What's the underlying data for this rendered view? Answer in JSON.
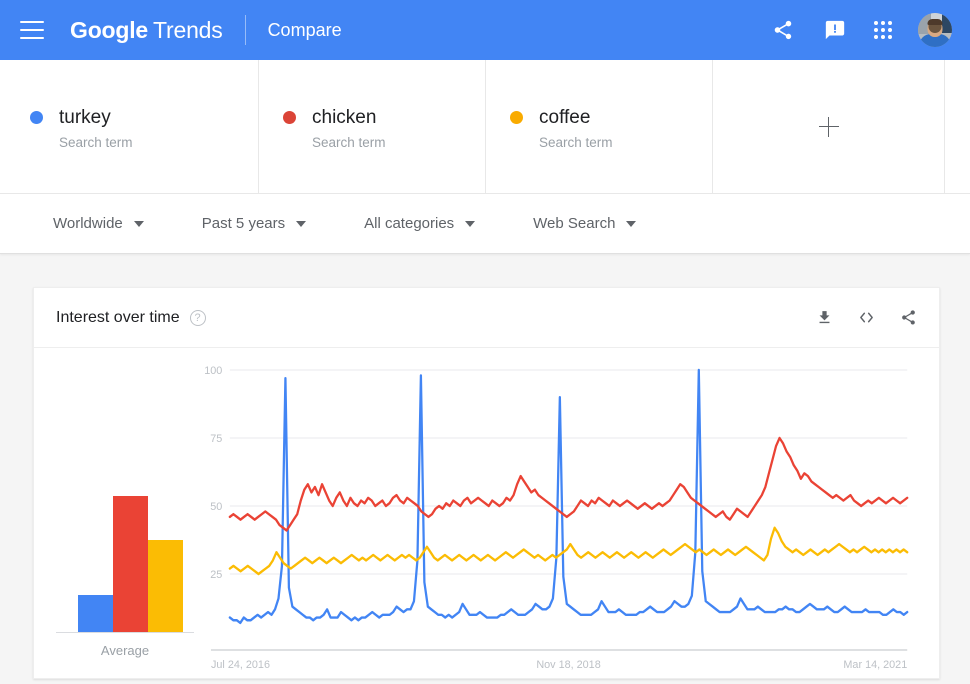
{
  "header": {
    "menu_icon": "hamburger-icon",
    "brand_google": "Google",
    "brand_trends": "Trends",
    "section": "Compare",
    "share_icon": "share-icon",
    "feedback_icon": "feedback-icon",
    "apps_icon": "apps-grid-icon",
    "avatar_icon": "user-avatar"
  },
  "terms": [
    {
      "name": "turkey",
      "type": "Search term",
      "color": "#4285F4"
    },
    {
      "name": "chicken",
      "type": "Search term",
      "color": "#DB4437"
    },
    {
      "name": "coffee",
      "type": "Search term",
      "color": "#F9AB00"
    }
  ],
  "add_term": {
    "label": "+",
    "icon": "plus-icon"
  },
  "filters": [
    {
      "label": "Worldwide"
    },
    {
      "label": "Past 5 years"
    },
    {
      "label": "All categories"
    },
    {
      "label": "Web Search"
    }
  ],
  "card": {
    "title": "Interest over time",
    "help_icon": "help-icon",
    "download_icon": "download-icon",
    "embed_icon": "embed-code-icon",
    "share_icon": "share-icon"
  },
  "chart_data": {
    "type": "line",
    "title": "Interest over time",
    "xlabel": "",
    "ylabel": "",
    "ylim": [
      0,
      100
    ],
    "yticks": [
      25,
      50,
      75,
      100
    ],
    "grid": true,
    "legend_position": "top-cards",
    "x_tick_labels": [
      "Jul 24, 2016",
      "Nov 18, 2018",
      "Mar 14, 2021"
    ],
    "x_tick_positions": [
      0,
      0.5,
      1.0
    ],
    "average_bar": {
      "type": "bar",
      "label": "Average",
      "categories": [
        "turkey",
        "chicken",
        "coffee"
      ],
      "values": [
        13,
        47,
        32
      ],
      "colors": [
        "#4285F4",
        "#EA4335",
        "#FBBC04"
      ]
    },
    "series": [
      {
        "name": "turkey",
        "color": "#4285F4",
        "values": [
          9,
          8,
          8,
          7,
          9,
          8,
          8,
          9,
          10,
          9,
          10,
          11,
          10,
          12,
          16,
          28,
          97,
          20,
          13,
          12,
          11,
          10,
          9,
          9,
          8,
          9,
          9,
          10,
          12,
          9,
          9,
          9,
          11,
          10,
          9,
          8,
          9,
          8,
          9,
          9,
          10,
          11,
          10,
          9,
          10,
          10,
          10,
          11,
          13,
          12,
          11,
          12,
          12,
          15,
          30,
          98,
          22,
          13,
          12,
          11,
          10,
          10,
          9,
          10,
          9,
          10,
          11,
          14,
          12,
          10,
          10,
          10,
          11,
          10,
          9,
          9,
          9,
          9,
          10,
          10,
          11,
          12,
          11,
          10,
          10,
          10,
          11,
          12,
          14,
          13,
          12,
          12,
          13,
          16,
          31,
          90,
          24,
          14,
          13,
          12,
          11,
          10,
          10,
          10,
          10,
          11,
          12,
          15,
          13,
          11,
          11,
          11,
          12,
          11,
          10,
          10,
          10,
          10,
          11,
          11,
          12,
          13,
          12,
          11,
          11,
          11,
          12,
          13,
          15,
          14,
          13,
          13,
          14,
          17,
          33,
          100,
          26,
          15,
          14,
          13,
          12,
          11,
          11,
          11,
          11,
          12,
          13,
          16,
          14,
          12,
          12,
          12,
          13,
          12,
          11,
          11,
          11,
          11,
          12,
          12,
          13,
          12,
          12,
          11,
          11,
          12,
          13,
          14,
          13,
          12,
          12,
          12,
          13,
          12,
          11,
          11,
          12,
          13,
          12,
          11,
          11,
          11,
          11,
          12,
          11,
          11,
          11,
          11,
          10,
          10,
          11,
          12,
          11,
          11,
          10,
          11
        ]
      },
      {
        "name": "chicken",
        "color": "#EA4335",
        "values": [
          46,
          47,
          46,
          45,
          46,
          47,
          46,
          45,
          46,
          47,
          48,
          47,
          46,
          45,
          43,
          42,
          41,
          43,
          45,
          47,
          52,
          56,
          58,
          55,
          57,
          54,
          58,
          55,
          52,
          50,
          53,
          55,
          52,
          50,
          53,
          51,
          50,
          52,
          51,
          53,
          52,
          50,
          51,
          52,
          50,
          51,
          53,
          54,
          52,
          51,
          53,
          52,
          51,
          50,
          48,
          47,
          46,
          47,
          49,
          50,
          49,
          51,
          50,
          52,
          51,
          50,
          52,
          53,
          51,
          52,
          53,
          52,
          51,
          50,
          52,
          51,
          50,
          51,
          53,
          52,
          54,
          58,
          61,
          59,
          57,
          55,
          56,
          54,
          53,
          52,
          51,
          50,
          49,
          48,
          47,
          46,
          47,
          48,
          50,
          52,
          51,
          50,
          52,
          51,
          53,
          52,
          51,
          50,
          52,
          51,
          50,
          51,
          52,
          51,
          50,
          49,
          50,
          51,
          50,
          49,
          50,
          51,
          50,
          51,
          52,
          54,
          56,
          58,
          57,
          55,
          53,
          52,
          51,
          50,
          49,
          48,
          47,
          46,
          47,
          48,
          46,
          45,
          47,
          49,
          48,
          47,
          46,
          48,
          50,
          52,
          54,
          57,
          62,
          67,
          72,
          75,
          73,
          70,
          68,
          65,
          63,
          60,
          62,
          61,
          59,
          58,
          57,
          56,
          55,
          54,
          53,
          54,
          53,
          52,
          53,
          54,
          52,
          51,
          50,
          51,
          52,
          51,
          52,
          53,
          52,
          51,
          52,
          53,
          52,
          51,
          52,
          53
        ]
      },
      {
        "name": "coffee",
        "color": "#FBBC04",
        "values": [
          27,
          28,
          27,
          26,
          27,
          28,
          27,
          26,
          25,
          26,
          27,
          28,
          30,
          33,
          31,
          29,
          28,
          27,
          28,
          29,
          30,
          31,
          30,
          29,
          30,
          31,
          30,
          29,
          30,
          31,
          30,
          29,
          30,
          31,
          32,
          31,
          30,
          31,
          30,
          31,
          32,
          31,
          30,
          31,
          32,
          31,
          30,
          31,
          32,
          31,
          32,
          31,
          30,
          31,
          33,
          35,
          33,
          31,
          30,
          31,
          32,
          31,
          30,
          31,
          32,
          31,
          30,
          31,
          32,
          31,
          30,
          31,
          32,
          31,
          30,
          31,
          32,
          33,
          32,
          31,
          32,
          33,
          34,
          33,
          32,
          31,
          32,
          31,
          30,
          31,
          32,
          31,
          32,
          33,
          34,
          36,
          34,
          32,
          31,
          32,
          33,
          32,
          31,
          32,
          33,
          32,
          31,
          32,
          33,
          32,
          31,
          32,
          33,
          32,
          31,
          32,
          33,
          32,
          31,
          32,
          33,
          34,
          33,
          32,
          33,
          34,
          35,
          36,
          35,
          34,
          33,
          34,
          33,
          32,
          33,
          34,
          33,
          32,
          33,
          34,
          33,
          32,
          33,
          34,
          35,
          34,
          33,
          32,
          31,
          30,
          32,
          38,
          42,
          40,
          37,
          35,
          34,
          33,
          34,
          33,
          32,
          33,
          34,
          33,
          32,
          33,
          34,
          33,
          34,
          35,
          36,
          35,
          34,
          33,
          34,
          33,
          34,
          35,
          34,
          33,
          34,
          33,
          34,
          33,
          34,
          33,
          34,
          33,
          34,
          33
        ]
      }
    ]
  }
}
